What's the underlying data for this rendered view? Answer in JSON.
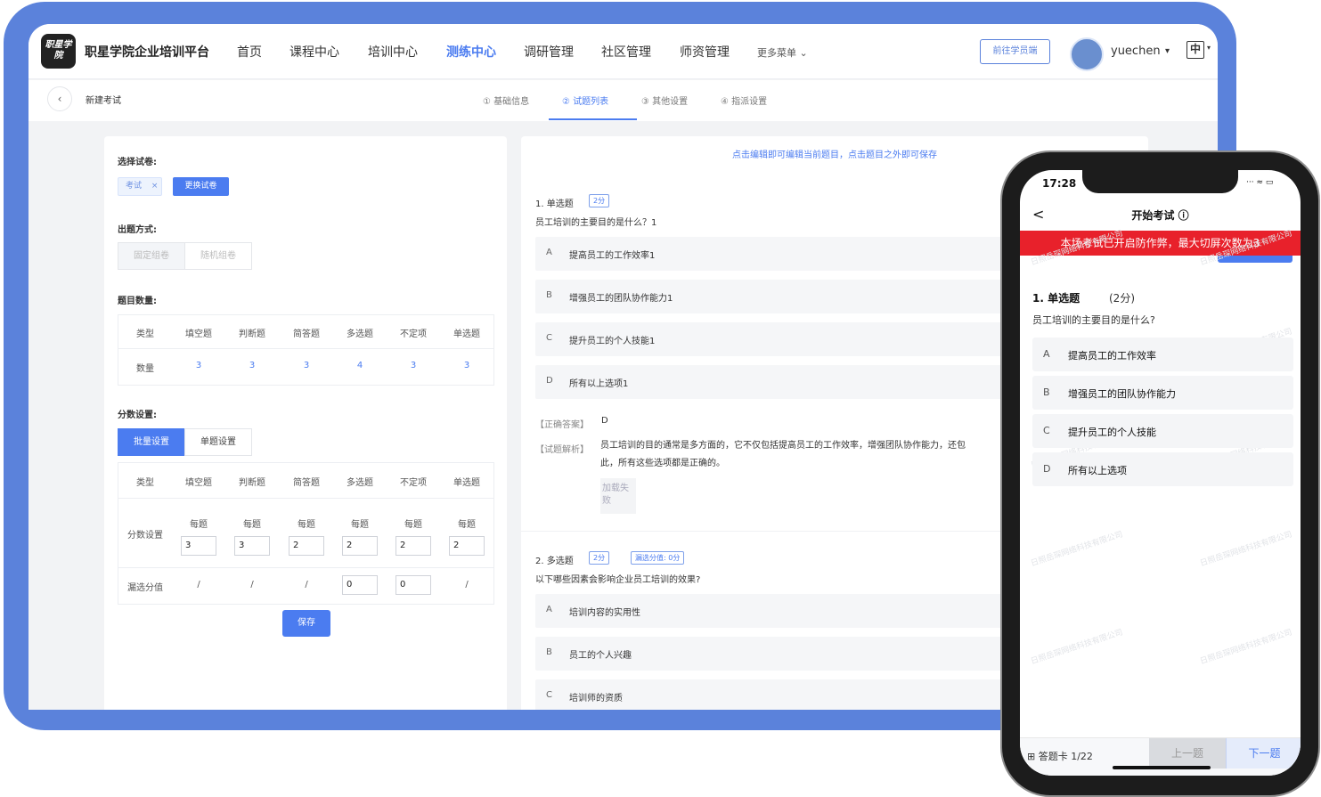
{
  "header": {
    "logo_text": "职星学院",
    "brand": "职星学院企业培训平台",
    "nav": [
      "首页",
      "课程中心",
      "培训中心",
      "测练中心",
      "调研管理",
      "社区管理",
      "师资管理"
    ],
    "more": "更多菜单",
    "go_student": "前往学员端",
    "username": "yuechen",
    "lang": "中"
  },
  "subbar": {
    "title": "新建考试",
    "steps": [
      "① 基础信息",
      "② 试题列表",
      "③ 其他设置",
      "④ 指派设置"
    ]
  },
  "left": {
    "paper_label": "选择试卷:",
    "paper_tag": "考试",
    "tag_close": "×",
    "change_btn": "更换试卷",
    "mode_label": "出题方式:",
    "mode_fixed": "固定组卷",
    "mode_random": "随机组卷",
    "count_label": "题目数量:",
    "count_headers": [
      "类型",
      "填空题",
      "判断题",
      "简答题",
      "多选题",
      "不定项",
      "单选题"
    ],
    "count_row_label": "数量",
    "counts": [
      "3",
      "3",
      "3",
      "4",
      "3",
      "3"
    ],
    "score_label": "分数设置:",
    "score_batch": "批量设置",
    "score_single": "单题设置",
    "score_headers": [
      "类型",
      "填空题",
      "判断题",
      "简答题",
      "多选题",
      "不定项",
      "单选题"
    ],
    "score_row_label": "分数设置",
    "per_q": "每题",
    "scores": [
      "3",
      "3",
      "2",
      "2",
      "2",
      "2"
    ],
    "miss_row_label": "漏选分值",
    "miss": [
      "/",
      "/",
      "/",
      "0",
      "0",
      "/"
    ],
    "save": "保存"
  },
  "right": {
    "hint": "点击编辑即可编辑当前题目，点击题目之外即可保存",
    "q1": {
      "head": "1. 单选题",
      "score": "2分",
      "text": "员工培训的主要目的是什么？1",
      "options": [
        {
          "label": "A",
          "text": "提高员工的工作效率1"
        },
        {
          "label": "B",
          "text": "增强员工的团队协作能力1"
        },
        {
          "label": "C",
          "text": "提升员工的个人技能1"
        },
        {
          "label": "D",
          "text": "所有以上选项1"
        }
      ],
      "answer_label": "【正确答案】",
      "answer": "D",
      "analysis_label": "【试题解析】",
      "analysis_1": "员工培训的目的通常是多方面的，它不仅包括提高员工的工作效率，增强团队协作能力，还包",
      "analysis_2": "此，所有这些选项都是正确的。",
      "load_fail": "加载失败"
    },
    "q2": {
      "head": "2. 多选题",
      "score": "2分",
      "miss": "漏选分值: 0分",
      "text": "以下哪些因素会影响企业员工培训的效果?",
      "options": [
        {
          "label": "A",
          "text": "培训内容的实用性"
        },
        {
          "label": "B",
          "text": "员工的个人兴趣"
        },
        {
          "label": "C",
          "text": "培训师的资质"
        }
      ]
    }
  },
  "phone": {
    "time": "17:28",
    "status": "⋅⋅⋅ ≈ ▭",
    "back": "<",
    "title": "开始考试 ⓘ",
    "warning": "本场考试已开启防作弊，最大切屏次数为3",
    "q_head": "1. 单选题",
    "q_score": "(2分)",
    "q_text": "员工培训的主要目的是什么?",
    "options": [
      {
        "label": "A",
        "text": "提高员工的工作效率"
      },
      {
        "label": "B",
        "text": "增强员工的团队协作能力"
      },
      {
        "label": "C",
        "text": "提升员工的个人技能"
      },
      {
        "label": "D",
        "text": "所有以上选项"
      }
    ],
    "watermark": "日照岳琛网络科技有限公司",
    "answer_card": "答题卡 1/22",
    "prev": "上一题",
    "next": "下一题"
  }
}
